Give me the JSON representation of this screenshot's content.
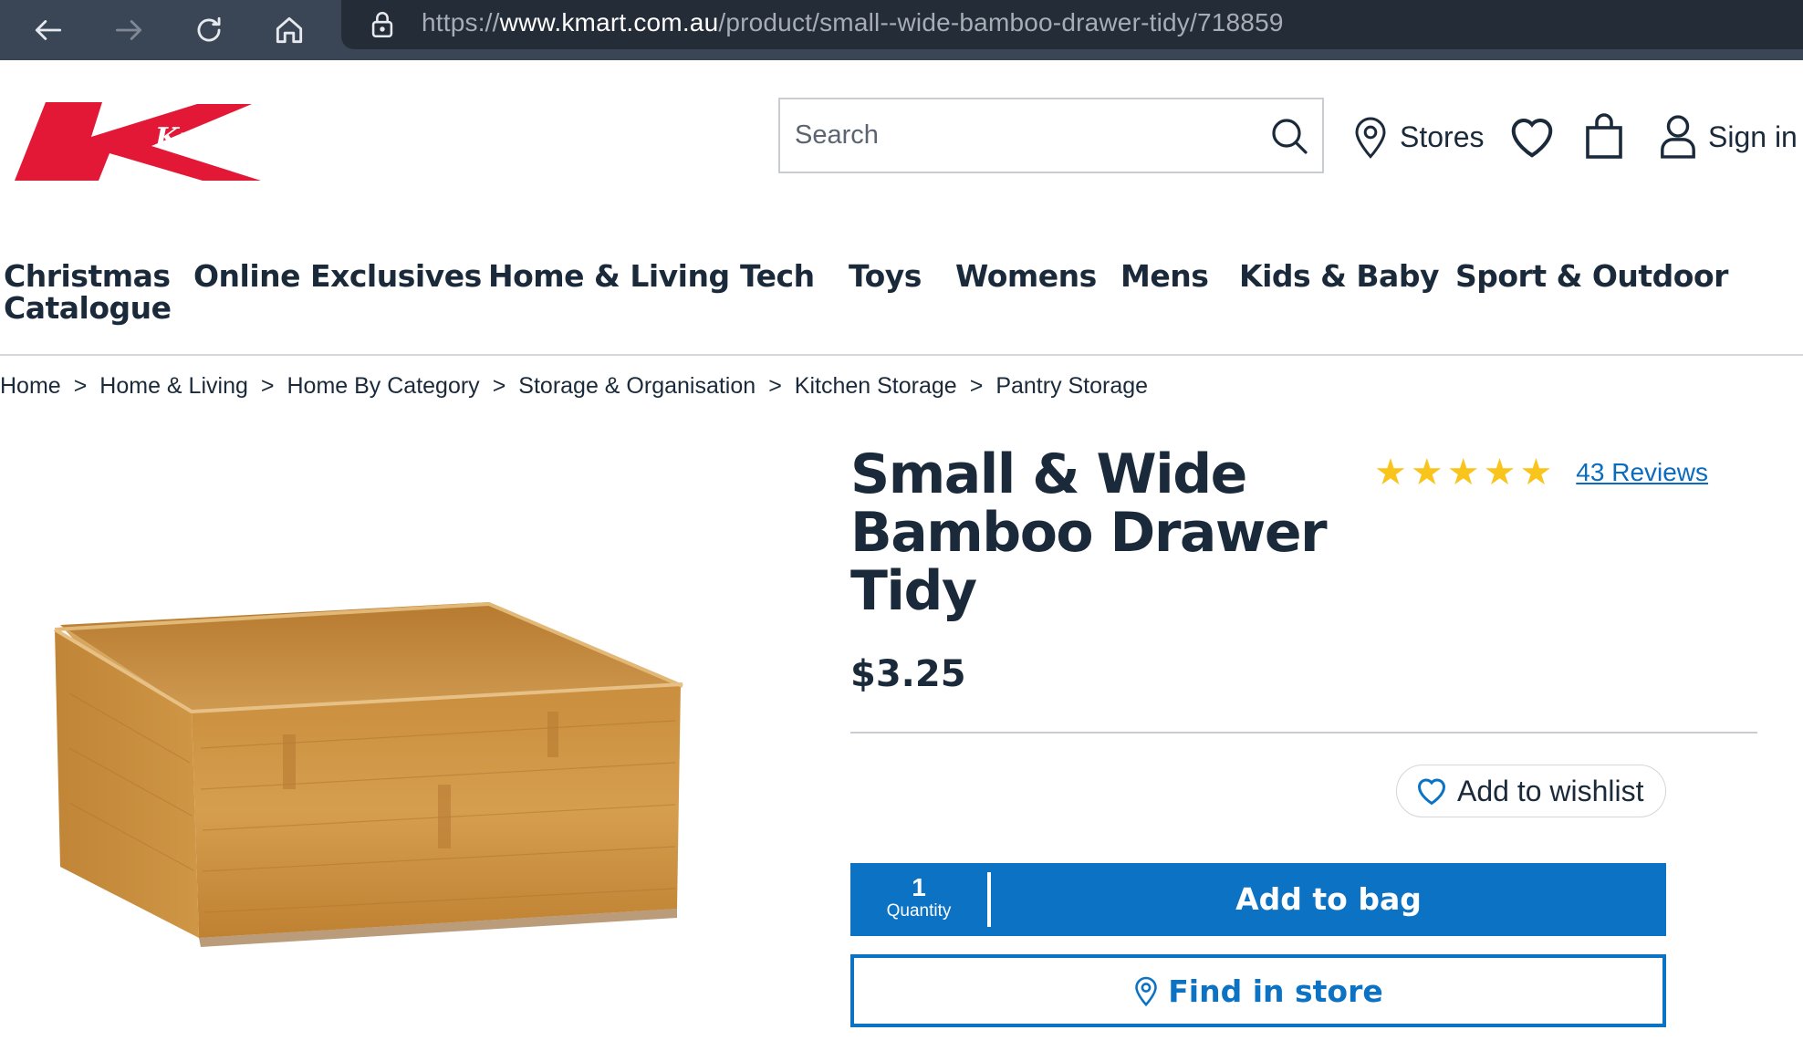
{
  "browser": {
    "url_scheme": "https://",
    "url_host": "www.kmart.com.au",
    "url_path": "/product/small--wide-bamboo-drawer-tidy/718859",
    "icons": [
      "back-arrow-icon",
      "forward-arrow-icon",
      "reload-icon",
      "home-icon",
      "lock-icon"
    ]
  },
  "header": {
    "logo_text": "Kmart",
    "search_placeholder": "Search",
    "stores_label": "Stores",
    "sign_in_label": "Sign in",
    "brand_color": "#e31837",
    "accent_color": "#0b72c4"
  },
  "nav": {
    "items": [
      {
        "label": "Christmas Catalogue"
      },
      {
        "label": "Online Exclusives"
      },
      {
        "label": "Home & Living"
      },
      {
        "label": "Tech"
      },
      {
        "label": "Toys"
      },
      {
        "label": "Womens"
      },
      {
        "label": "Mens"
      },
      {
        "label": "Kids & Baby"
      },
      {
        "label": "Sport & Outdoor"
      }
    ]
  },
  "breadcrumb": {
    "separator": ">",
    "items": [
      "Home",
      "Home & Living",
      "Home By Category",
      "Storage & Organisation",
      "Kitchen Storage",
      "Pantry Storage"
    ]
  },
  "product": {
    "title": "Small & Wide Bamboo Drawer Tidy",
    "rating": 5,
    "rating_max": 5,
    "reviews_label": "43 Reviews",
    "price": "$3.25",
    "wishlist_label": "Add to wishlist",
    "quantity_value": "1",
    "quantity_label": "Quantity",
    "add_to_bag_label": "Add to bag",
    "find_in_store_label": "Find in store",
    "star_color": "#f9c41b"
  }
}
